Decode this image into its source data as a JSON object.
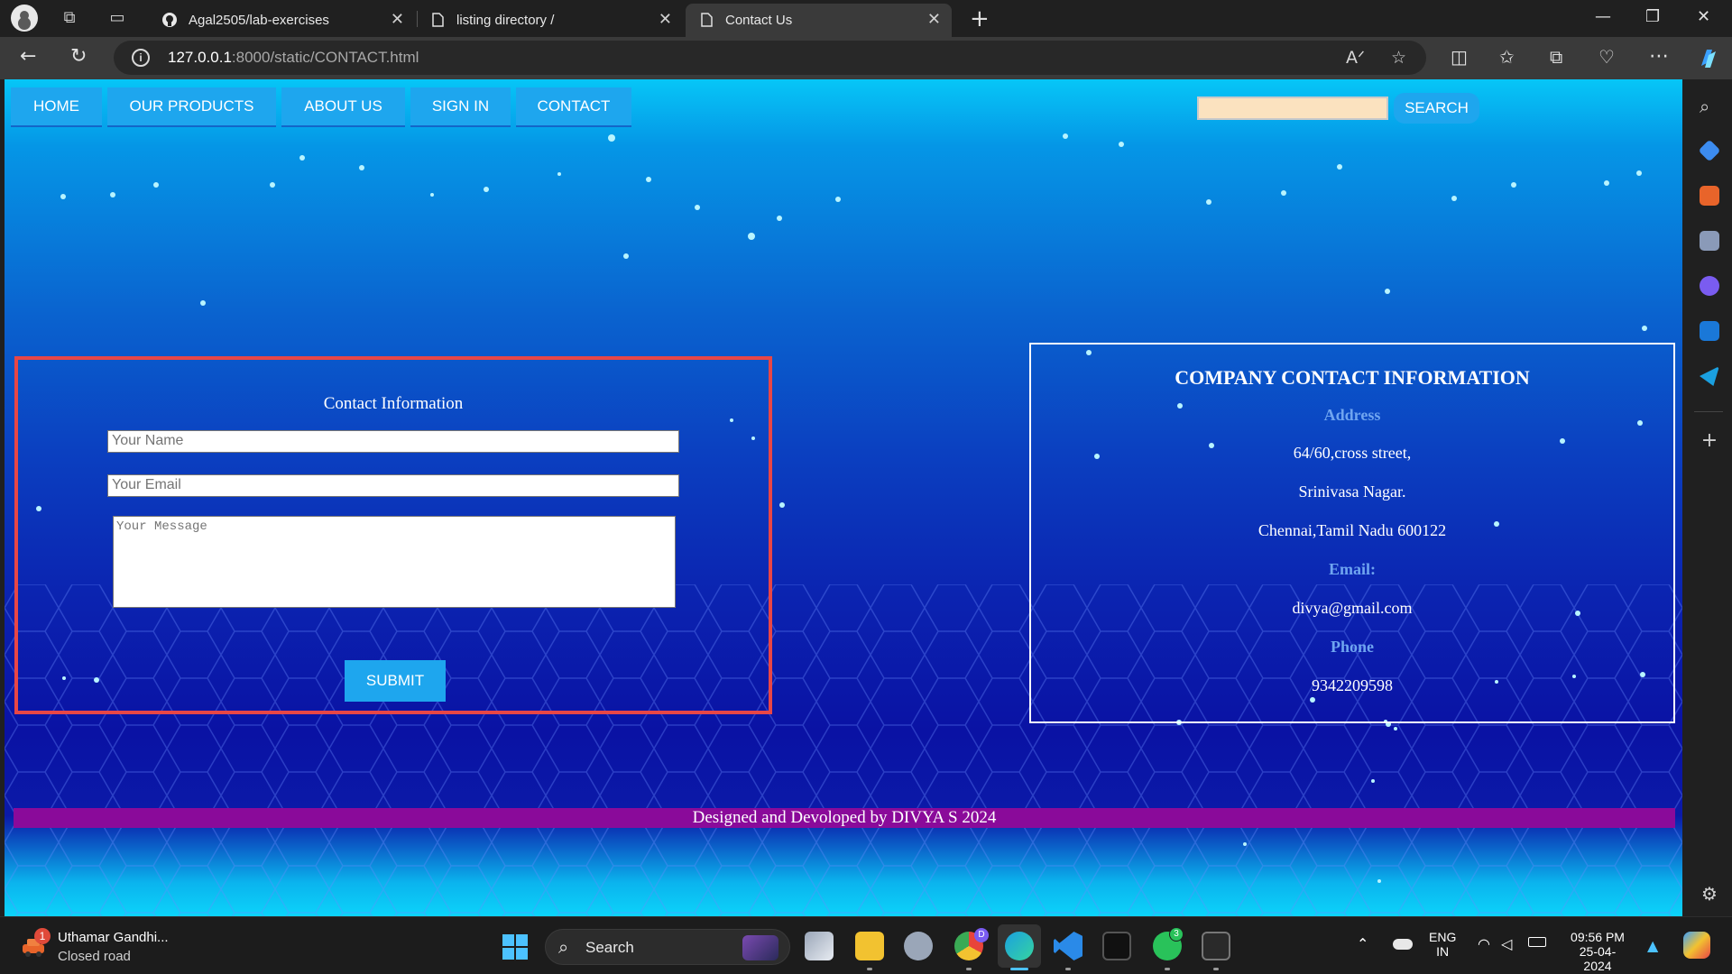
{
  "browser": {
    "tabs": [
      {
        "title": "Agal2505/lab-exercises",
        "active": false
      },
      {
        "title": "listing directory /",
        "active": false
      },
      {
        "title": "Contact Us",
        "active": true
      }
    ],
    "url": {
      "host": "127.0.0.1",
      "rest": ":8000/static/CONTACT.html"
    }
  },
  "page": {
    "menu": [
      "HOME",
      "OUR PRODUCTS",
      "ABOUT US",
      "SIGN IN",
      "CONTACT"
    ],
    "search_button": "SEARCH",
    "search_value": "",
    "form": {
      "title": "Contact Information",
      "name_placeholder": "Your Name",
      "email_placeholder": "Your Email",
      "message_placeholder": "Your Message",
      "submit_label": "SUBMIT"
    },
    "company": {
      "title": "COMPANY CONTACT INFORMATION",
      "address_label": "Address",
      "address_line1": "64/60,cross street,",
      "address_line2": "Srinivasa Nagar.",
      "address_line3": "Chennai,Tamil Nadu 600122",
      "email_label": "Email:",
      "email": "divya@gmail.com",
      "phone_label": "Phone",
      "phone": "9342209598"
    },
    "footer": "Designed and Devoloped by DIVYA S 2024"
  },
  "taskbar": {
    "news_title": "Uthamar Gandhi...",
    "news_sub": "Closed road",
    "news_badge": "1",
    "search_label": "Search",
    "chrome_badge": "D",
    "whatsapp_badge": "3",
    "lang_line1": "ENG",
    "lang_line2": "IN",
    "time": "09:56 PM",
    "date": "25-04-2024"
  },
  "colors": {
    "menu_bg": "#1ea6ee",
    "form_border": "#e84646",
    "footer_bg": "#8a0a9a",
    "label_color": "#6fa5f0",
    "search_bg": "#fbe2bf"
  }
}
